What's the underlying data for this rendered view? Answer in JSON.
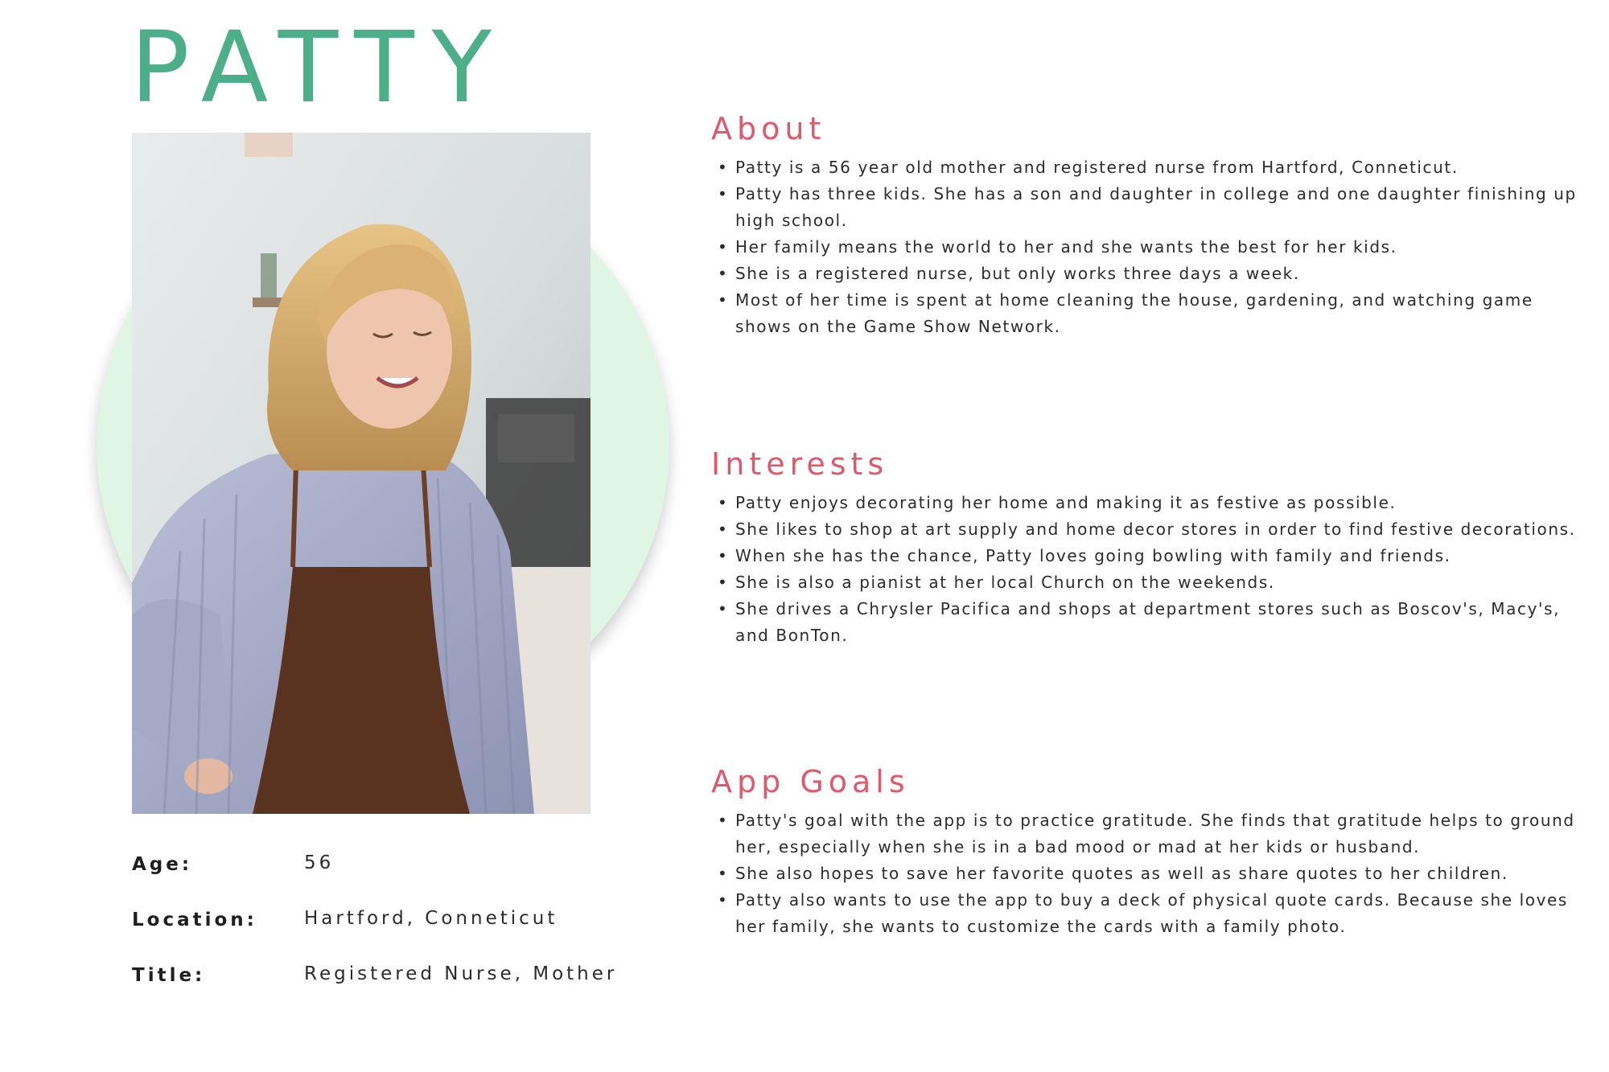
{
  "persona": {
    "name": "PATTY"
  },
  "photo": {
    "icon": "portrait-photo"
  },
  "info": [
    {
      "label": "Age:",
      "value": "56"
    },
    {
      "label": "Location:",
      "value": "Hartford, Conneticut"
    },
    {
      "label": "Title:",
      "value": "Registered Nurse, Mother"
    }
  ],
  "sections": {
    "about": {
      "heading": "About",
      "items": [
        "Patty is a 56 year old mother and registered nurse from Hartford, Conneticut.",
        "Patty has three kids. She has a son and daughter in college and one daughter finishing up high school.",
        "Her family means the world to her and she wants the best for her kids.",
        "She is a registered nurse, but only works three days a week.",
        "Most of her time is spent at home cleaning the house, gardening, and watching game shows on the Game Show Network."
      ]
    },
    "interests": {
      "heading": "Interests",
      "items": [
        "Patty enjoys decorating her home and making it as festive as possible.",
        "She likes to shop at art supply and home decor stores in order to find festive decorations.",
        "When she has the chance, Patty loves going bowling with family and friends.",
        "She is also a pianist at her local Church on the weekends.",
        "She drives a Chrysler Pacifica and shops at department stores such as Boscov's, Macy's, and BonTon."
      ]
    },
    "app_goals": {
      "heading": "App Goals",
      "items": [
        "Patty's goal with the app is to practice gratitude. She finds that gratitude helps to ground her, especially when she is in a bad mood or mad at her kids or husband.",
        "She also hopes to save her favorite quotes as well as share quotes to her children.",
        "Patty also wants to use the app to buy a deck of physical quote cards. Because she loves her family, she wants to customize the cards with a family photo."
      ]
    }
  },
  "colors": {
    "name_accent": "#4daf8a",
    "heading_accent": "#e0596b",
    "circle_fill": "#dff6e5"
  }
}
